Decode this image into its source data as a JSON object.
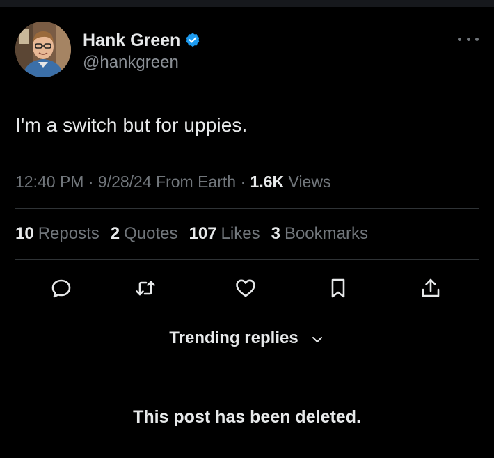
{
  "author": {
    "display_name": "Hank Green",
    "handle": "@hankgreen",
    "verified": true,
    "avatar_icon": "profile-avatar"
  },
  "post": {
    "text": "I'm a switch but for uppies.",
    "time": "12:40 PM",
    "date": "9/28/24",
    "location": "From Earth",
    "views_count": "1.6K",
    "views_label": "Views"
  },
  "stats": {
    "reposts": {
      "count": "10",
      "label": "Reposts"
    },
    "quotes": {
      "count": "2",
      "label": "Quotes"
    },
    "likes": {
      "count": "107",
      "label": "Likes"
    },
    "bookmarks": {
      "count": "3",
      "label": "Bookmarks"
    }
  },
  "actions": [
    "reply-icon",
    "repost-icon",
    "like-icon",
    "bookmark-icon",
    "share-icon"
  ],
  "replies": {
    "sort_label": "Trending replies",
    "deleted_notice": "This post has been deleted."
  },
  "colors": {
    "background": "#000000",
    "text_primary": "#e7e9ea",
    "text_secondary": "#71767b",
    "divider": "#2f3336",
    "verified_blue": "#1d9bf0"
  }
}
